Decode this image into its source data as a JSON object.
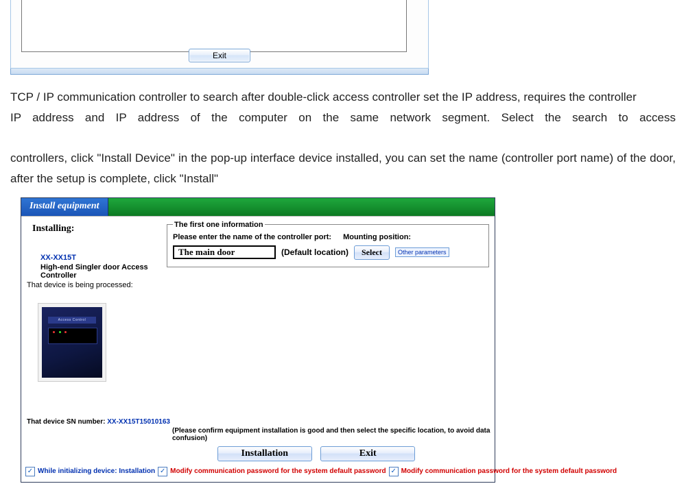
{
  "top_dialog": {
    "exit_label": "Exit"
  },
  "doc": {
    "p1": "TCP / IP communication controller to search after double-click access controller set the IP address, requires the controller",
    "p2a": "IP address and IP address of the computer on the same network segment. Select the search to access",
    "p2b": "controllers, click \"Install Device\" in the pop-up interface device installed, you can set the name (controller port name) of the door, after the setup is complete, click \"Install\""
  },
  "dialog": {
    "title": "Install equipment",
    "left": {
      "header": "Installing:",
      "model": "XX-XX15T",
      "desc": "High-end Singler door Access Controller",
      "processed": "That device is being processed:",
      "thumb_label": "Access Control"
    },
    "first": {
      "legend": "The first one information",
      "enter_name": "Please enter the name of the controller port:",
      "mounting": "Mounting position:",
      "door_value": "The main door",
      "default_loc": "(Default location)",
      "select": "Select",
      "other": "Other parameters"
    },
    "sn": {
      "label": "That device SN number:",
      "value": "XX-XX15T15010163"
    },
    "warn": "(Please confirm equipment installation is good and then select the specific location, to avoid data confusion)",
    "buttons": {
      "install": "Installation",
      "exit": "Exit"
    },
    "checks": {
      "c1": "While initializing device: Installation",
      "c2": "Modify communication password for the system default password",
      "c3": "Modify communication password for the system default password"
    }
  }
}
